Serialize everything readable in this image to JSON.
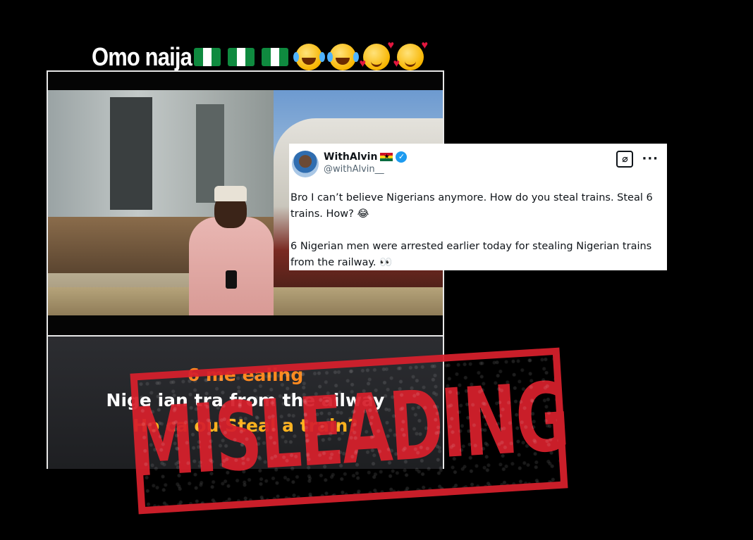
{
  "caption": {
    "text": "Omo naija",
    "emoji": [
      "nigeria-flag",
      "nigeria-flag",
      "nigeria-flag",
      "tears-of-joy",
      "tears-of-joy",
      "smiling-face-with-hearts",
      "smiling-face-with-hearts"
    ]
  },
  "video": {
    "subtitles": [
      "6 me                               ealing",
      "Nige  ian tra  from the  ailway",
      "Ho   ca   ou Steal a train?"
    ]
  },
  "tweet": {
    "display_name": "WithAlvin",
    "handle": "@withAlvin__",
    "verified": true,
    "paragraph_1": "Bro I can’t believe Nigerians anymore. How do you steal trains. Steal 6 trains. How? 😂",
    "paragraph_2": "6 Nigerian men were arrested earlier today for stealing Nigerian trains from the railway. 👀",
    "more_label": "···"
  },
  "stamp": {
    "label": "MISLEADING",
    "color": "#d6202c"
  }
}
